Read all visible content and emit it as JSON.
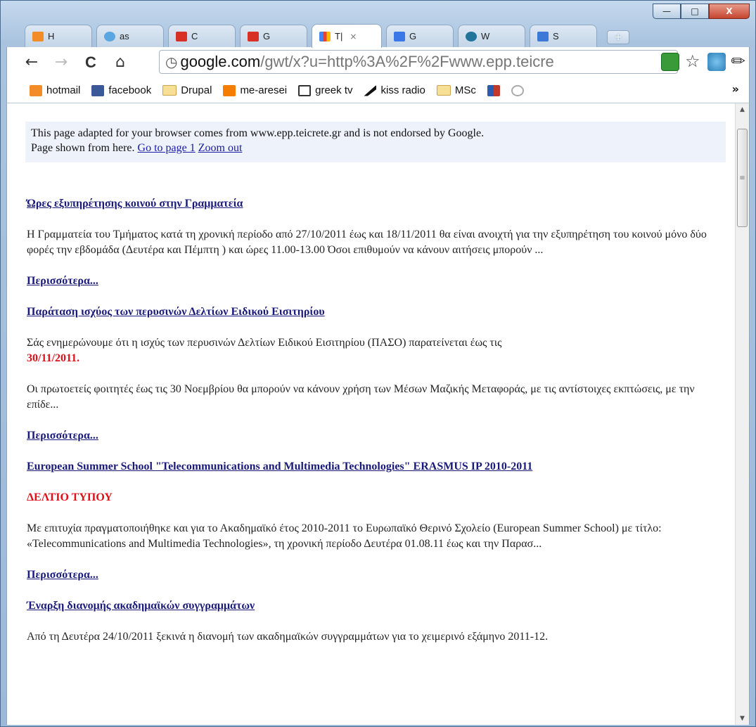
{
  "window": {
    "minimize_glyph": "—",
    "maximize_glyph": "□",
    "close_glyph": "X"
  },
  "tabs": [
    {
      "label": "H",
      "icon": "hotmail-icon",
      "color": "#f28c28"
    },
    {
      "label": "as",
      "icon": "heart-icon",
      "color": "#5aa6e0"
    },
    {
      "label": "C",
      "icon": "gmail-icon",
      "color": "#d93025"
    },
    {
      "label": "G",
      "icon": "gmail-icon",
      "color": "#d93025"
    },
    {
      "label": "T|",
      "icon": "google-icon",
      "color": "#4285f4",
      "active": true
    },
    {
      "label": "G",
      "icon": "translate-icon",
      "color": "#3b78e7"
    },
    {
      "label": "W",
      "icon": "wordpress-icon",
      "color": "#21759b"
    },
    {
      "label": "S",
      "icon": "doc-icon",
      "color": "#3c78d8"
    }
  ],
  "toolbar": {
    "back_glyph": "←",
    "forward_glyph": "→",
    "reload_glyph": "C",
    "home_glyph": "⌂",
    "url_host": "google.com",
    "url_path": "/gwt/x?u=http%3A%2F%2Fwww.epp.teicre",
    "star_glyph": "☆",
    "wrench_glyph": "✎"
  },
  "bookmarks": {
    "items": [
      {
        "label": "hotmail",
        "icon": "hotmail-icon",
        "color": "#f28c28"
      },
      {
        "label": "facebook",
        "icon": "facebook-icon",
        "color": "#3b5998"
      },
      {
        "label": "Drupal",
        "icon": "folder-icon"
      },
      {
        "label": "me-aresei",
        "icon": "blogger-icon",
        "color": "#f57d00"
      },
      {
        "label": "greek tv",
        "icon": "tv-icon",
        "color": "#333333"
      },
      {
        "label": "kiss radio",
        "icon": "radio-icon",
        "color": "#111111"
      },
      {
        "label": "MSc",
        "icon": "folder-icon"
      },
      {
        "label": "",
        "icon": "flag-icon",
        "color": "#c0392b"
      },
      {
        "label": "",
        "icon": "chrome-icon",
        "color": "#888888"
      }
    ],
    "more_glyph": "»"
  },
  "page": {
    "notice_line1": "This page adapted for your browser comes from www.epp.teicrete.gr and is not endorsed by Google.",
    "notice_line2_prefix": "Page shown from here. ",
    "goto_link": "Go to page 1",
    "zoom_link": "Zoom out",
    "more_label": "Περισσότερα...",
    "articles": [
      {
        "title": "Ώρες εξυπηρέτησης κοινού στην Γραμματεία",
        "body": "Η Γραμματεία του Τμήματος κατά τη χρονική περίοδο από 27/10/2011 έως και 18/11/2011 θα είναι ανοιχτή για την εξυπηρέτηση του κοινού μόνο δύο φορές την εβδομάδα  (Δευτέρα και Πέμπτη ) και ώρες 11.00-13.00 Όσοι επιθυμούν να κάνουν αιτήσεις μπορούν ..."
      },
      {
        "title": "Παράταση ισχύος των περυσινών Δελτίων Ειδικού Εισιτηρίου",
        "body": "Σάς ενημερώνουμε ότι η ισχύς των περυσινών Δελτίων Ειδικού Εισιτηρίου (ΠΑΣΟ) παρατείνεται έως τις",
        "highlight": "30/11/2011.",
        "body2": "Οι πρωτοετείς φοιτητές έως τις 30 Νοεμβρίου θα μπορούν να κάνουν χρήση των Μέσων Μαζικής Μεταφοράς, με τις αντίστοιχες εκπτώσεις, με την επίδε..."
      },
      {
        "title": "European Summer School \"Telecommunications and Multimedia Technologies\" ERASMUS IP 2010-2011",
        "subtitle": "ΔΕΛΤΙΟ ΤΥΠΟΥ",
        "body": "Με επιτυχία πραγματοποιήθηκε και για το Ακαδημαϊκό έτος 2010-2011 το  Ευρωπαϊκό Θερινό Σχολείο (European Summer School) με τίτλο: «Telecommunications and Multimedia Technologies», τη χρονική περίοδο Δευτέρα 01.08.11 έως και την Παρασ..."
      },
      {
        "title": "Έναρξη διανομής ακαδημαϊκών συγγραμμάτων",
        "body": "Από τη Δευτέρα 24/10/2011 ξεκινά η διανομή των ακαδημαϊκών συγγραμμάτων για το χειμερινό εξάμηνο 2011-12."
      }
    ]
  },
  "scrollbar": {
    "up_glyph": "▲",
    "down_glyph": "▼",
    "grip_glyph": "≡"
  }
}
